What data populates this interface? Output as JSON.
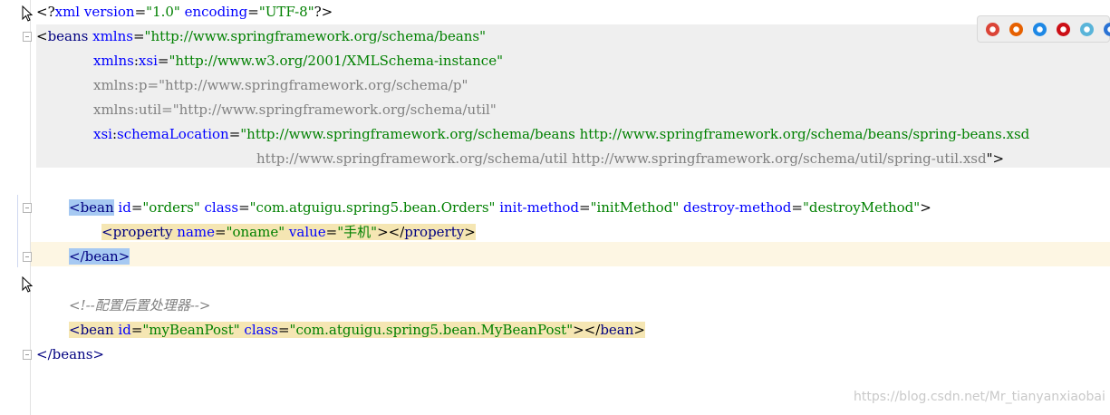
{
  "editor": {
    "lines": [
      {
        "parts": [
          {
            "t": "<?",
            "c": "punct"
          },
          {
            "t": "xml version",
            "c": "attr"
          },
          {
            "t": "=",
            "c": "punct"
          },
          {
            "t": "\"1.0\"",
            "c": "val"
          },
          {
            "t": " encoding",
            "c": "attr"
          },
          {
            "t": "=",
            "c": "punct"
          },
          {
            "t": "\"UTF-8\"",
            "c": "val"
          },
          {
            "t": "?>",
            "c": "punct"
          }
        ]
      },
      {
        "parts": [
          {
            "t": "<",
            "c": "punct"
          },
          {
            "t": "beans",
            "c": "tag"
          },
          {
            "t": " xmlns",
            "c": "attr"
          },
          {
            "t": "=",
            "c": "punct"
          },
          {
            "t": "\"http://www.springframework.org/schema/beans\"",
            "c": "val"
          }
        ]
      },
      {
        "parts": [
          {
            "t": "xmlns",
            "c": "attr"
          },
          {
            "t": ":",
            "c": "punct"
          },
          {
            "t": "xsi",
            "c": "attr"
          },
          {
            "t": "=",
            "c": "punct"
          },
          {
            "t": "\"http://www.w3.org/2001/XMLSchema-instance\"",
            "c": "val"
          }
        ]
      },
      {
        "parts": [
          {
            "t": "xmlns:p=\"http://www.springframework.org/schema/p\"",
            "c": "valgray"
          }
        ]
      },
      {
        "parts": [
          {
            "t": "xmlns:util=\"http://www.springframework.org/schema/util\"",
            "c": "valgray"
          }
        ]
      },
      {
        "parts": [
          {
            "t": "xsi",
            "c": "attr"
          },
          {
            "t": ":",
            "c": "punct"
          },
          {
            "t": "schemaLocation",
            "c": "attr"
          },
          {
            "t": "=",
            "c": "punct"
          },
          {
            "t": "\"http://www.springframework.org/schema/beans http://www.springframework.org/schema/beans/spring-beans.xsd",
            "c": "val"
          }
        ]
      },
      {
        "parts": [
          {
            "t": "http://www.springframework.org/schema/util http://www.springframework.org/schema/util/spring-util.xsd",
            "c": "valgray"
          },
          {
            "t": "\">",
            "c": "punct"
          }
        ]
      },
      {
        "parts": []
      },
      {
        "parts": [
          {
            "t": "<bean",
            "c": "tag",
            "hl": "sel"
          },
          {
            "t": " id",
            "c": "attr"
          },
          {
            "t": "=",
            "c": "punct"
          },
          {
            "t": "\"orders\"",
            "c": "val"
          },
          {
            "t": " class",
            "c": "attr"
          },
          {
            "t": "=",
            "c": "punct"
          },
          {
            "t": "\"com.atguigu.spring5.bean.Orders\"",
            "c": "val"
          },
          {
            "t": " init-method",
            "c": "attr"
          },
          {
            "t": "=",
            "c": "punct"
          },
          {
            "t": "\"initMethod\"",
            "c": "val"
          },
          {
            "t": " destroy-method",
            "c": "attr"
          },
          {
            "t": "=",
            "c": "punct"
          },
          {
            "t": "\"destroyMethod\"",
            "c": "val"
          },
          {
            "t": ">",
            "c": "punct"
          }
        ]
      },
      {
        "parts": [
          {
            "t": "<property",
            "c": "tag",
            "hl": "tag"
          },
          {
            "t": " name",
            "c": "attr",
            "hl": "tag"
          },
          {
            "t": "=",
            "c": "punct",
            "hl": "tag"
          },
          {
            "t": "\"oname\"",
            "c": "val",
            "hl": "tag"
          },
          {
            "t": " value",
            "c": "attr",
            "hl": "tag"
          },
          {
            "t": "=",
            "c": "punct",
            "hl": "tag"
          },
          {
            "t": "\"手机\"",
            "c": "val",
            "hl": "tag"
          },
          {
            "t": "></",
            "c": "punct",
            "hl": "tag"
          },
          {
            "t": "property",
            "c": "tag",
            "hl": "tag"
          },
          {
            "t": ">",
            "c": "punct",
            "hl": "tag"
          }
        ]
      },
      {
        "parts": [
          {
            "t": "</bean>",
            "c": "tag",
            "hl": "sel"
          }
        ]
      },
      {
        "parts": []
      },
      {
        "parts": [
          {
            "t": "<!--配置后置处理器-->",
            "c": "comment"
          }
        ]
      },
      {
        "parts": [
          {
            "t": "<bean",
            "c": "tag",
            "hl": "tag"
          },
          {
            "t": " id",
            "c": "attr",
            "hl": "tag"
          },
          {
            "t": "=",
            "c": "punct",
            "hl": "tag"
          },
          {
            "t": "\"myBeanPost\"",
            "c": "val",
            "hl": "tag"
          },
          {
            "t": " class",
            "c": "attr",
            "hl": "tag"
          },
          {
            "t": "=",
            "c": "punct",
            "hl": "tag"
          },
          {
            "t": "\"com.atguigu.spring5.bean.MyBeanPost\"",
            "c": "val",
            "hl": "tag"
          },
          {
            "t": "></",
            "c": "punct",
            "hl": "tag"
          },
          {
            "t": "bean",
            "c": "tag",
            "hl": "tag"
          },
          {
            "t": ">",
            "c": "punct",
            "hl": "tag"
          }
        ]
      },
      {
        "parts": [
          {
            "t": "</beans>",
            "c": "tag"
          }
        ]
      }
    ]
  },
  "browser_bar": {
    "icons": [
      {
        "name": "chrome-icon",
        "color": "#db4437"
      },
      {
        "name": "firefox-icon",
        "color": "#e66000"
      },
      {
        "name": "safari-icon",
        "color": "#1e88e5"
      },
      {
        "name": "opera-icon",
        "color": "#cc0f16"
      },
      {
        "name": "ie-icon",
        "color": "#59b4d9"
      },
      {
        "name": "edge-icon",
        "color": "#2b73d4"
      }
    ]
  },
  "watermark": "https://blog.csdn.net/Mr_tianyanxiaobai"
}
